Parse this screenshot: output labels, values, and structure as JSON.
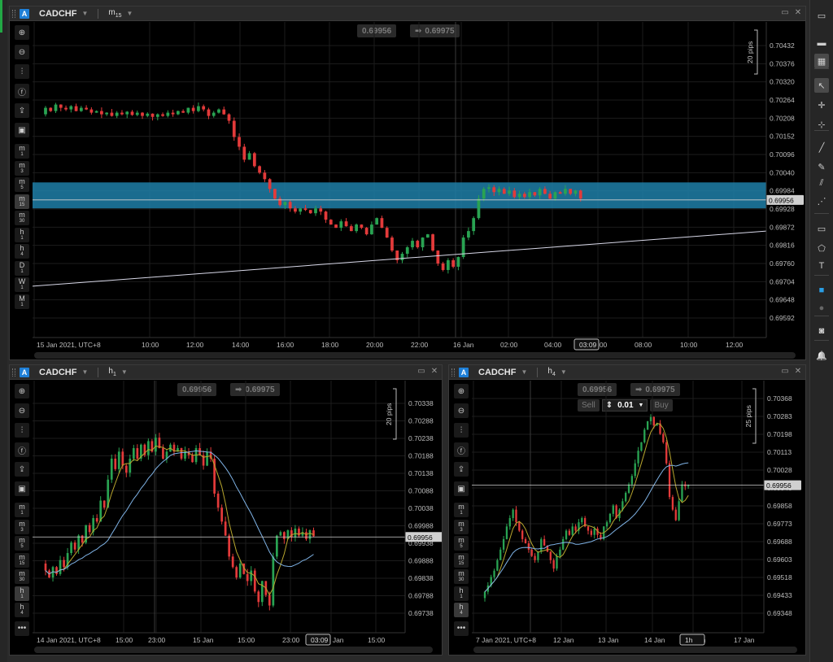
{
  "colors": {
    "bull": "#29a352",
    "bear": "#e33a3a",
    "zone": "#1e7fa8",
    "sma_fast": "#b8a62e",
    "sma_slow": "#7fb3e6",
    "trendline": "#d8d8e8"
  },
  "panels": [
    {
      "id": "top",
      "symbol": "CADCHF",
      "tf_main": "m",
      "tf_sub": "15",
      "bid": "0.69956",
      "ask": "0.69975",
      "arrow": "➡",
      "pips_label": "20 pips",
      "price_labels": [
        "0.70432",
        "0.70376",
        "0.70320",
        "0.70264",
        "0.70208",
        "0.70152",
        "0.70096",
        "0.70040",
        "0.69984",
        "0.69928",
        "0.69872",
        "0.69816",
        "0.69760",
        "0.69704",
        "0.69648",
        "0.69592"
      ],
      "current_price": "0.69956",
      "time_labels": [
        "15 Jan 2021, UTC+8",
        "10:00",
        "12:00",
        "14:00",
        "16:00",
        "18:00",
        "20:00",
        "22:00",
        "16 Jan",
        "02:00",
        "04:00",
        "06:00",
        "08:00",
        "10:00",
        "12:00"
      ],
      "cursor_time": "03:09",
      "left_tools": [
        "zoom-in",
        "zoom-out",
        "indicators",
        "facebook",
        "share",
        "screenshot"
      ],
      "timeframes": [
        {
          "main": "m",
          "sub": "1"
        },
        {
          "main": "m",
          "sub": "3"
        },
        {
          "main": "m",
          "sub": "5"
        },
        {
          "main": "m",
          "sub": "15"
        },
        {
          "main": "m",
          "sub": "30"
        },
        {
          "main": "h",
          "sub": "1"
        },
        {
          "main": "h",
          "sub": "4"
        },
        {
          "main": "D",
          "sub": "1"
        },
        {
          "main": "W",
          "sub": "1"
        },
        {
          "main": "M",
          "sub": "1"
        }
      ]
    },
    {
      "id": "bl",
      "symbol": "CADCHF",
      "tf_main": "h",
      "tf_sub": "1",
      "bid": "0.69956",
      "ask": "0.69975",
      "arrow": "➡",
      "pips_label": "20 pips",
      "price_labels": [
        "0.70338",
        "0.70288",
        "0.70238",
        "0.70188",
        "0.70138",
        "0.70088",
        "0.70038",
        "0.69988",
        "0.69938",
        "0.69888",
        "0.69838",
        "0.69788",
        "0.69738"
      ],
      "current_price": "0.69956",
      "time_labels": [
        "14 Jan 2021, UTC+8",
        "15:00",
        "23:00",
        "15 Jan",
        "15:00",
        "23:00",
        "16 Jan",
        "15:00"
      ],
      "cursor_time": "03:09",
      "more": "•••",
      "timeframes": [
        {
          "main": "m",
          "sub": "1"
        },
        {
          "main": "m",
          "sub": "3"
        },
        {
          "main": "m",
          "sub": "5"
        },
        {
          "main": "m",
          "sub": "15"
        },
        {
          "main": "m",
          "sub": "30"
        },
        {
          "main": "h",
          "sub": "1"
        },
        {
          "main": "h",
          "sub": "4"
        }
      ]
    },
    {
      "id": "br",
      "symbol": "CADCHF",
      "tf_main": "h",
      "tf_sub": "4",
      "bid": "0.69956",
      "ask": "0.69975",
      "arrow": "➡",
      "pips_label": "25 pips",
      "sell": "Sell",
      "buy": "Buy",
      "qty": "0.01",
      "price_labels": [
        "0.70368",
        "0.70283",
        "0.70198",
        "0.70113",
        "0.70028",
        "0.69943",
        "0.69858",
        "0.69773",
        "0.69688",
        "0.69603",
        "0.69518",
        "0.69433",
        "0.69348"
      ],
      "current_price": "0.69956",
      "time_labels": [
        "7 Jan 2021, UTC+8",
        "12 Jan",
        "13 Jan",
        "14 Jan",
        "16 Jan",
        "17 Jan"
      ],
      "cursor_time": "1h",
      "more": "•••",
      "timeframes": [
        {
          "main": "m",
          "sub": "1"
        },
        {
          "main": "m",
          "sub": "3"
        },
        {
          "main": "m",
          "sub": "5"
        },
        {
          "main": "m",
          "sub": "15"
        },
        {
          "main": "m",
          "sub": "30"
        },
        {
          "main": "h",
          "sub": "1"
        },
        {
          "main": "h",
          "sub": "4"
        }
      ]
    }
  ],
  "right_toolbar": [
    "single-layout",
    "split-layout",
    "multi-layout",
    "pointer",
    "crosshair",
    "measure",
    "line",
    "pencil",
    "fib",
    "channel",
    "rectangle",
    "shape",
    "text",
    "color",
    "circle",
    "screenshot",
    "alert"
  ]
}
